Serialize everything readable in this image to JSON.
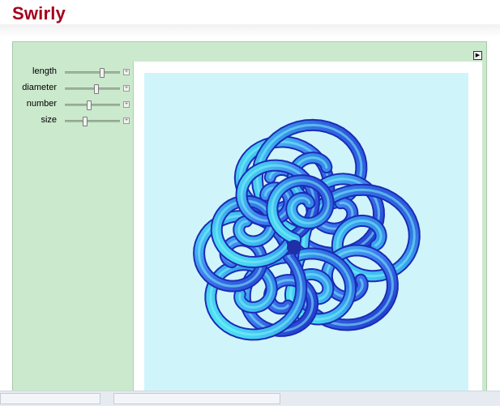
{
  "page": {
    "title": "Swirly"
  },
  "panel": {
    "toggle_icon": "play-triangle-icon"
  },
  "controls": [
    {
      "label": "length",
      "value": 0.7
    },
    {
      "label": "diameter",
      "value": 0.58
    },
    {
      "label": "number",
      "value": 0.43
    },
    {
      "label": "size",
      "value": 0.35
    }
  ],
  "colors": {
    "title": "#a3001e",
    "panel_background": "#cbe9cc",
    "graphic_background": "#cff5fb",
    "tube_dark": "#1f33c9",
    "tube_light": "#49e6f2"
  }
}
